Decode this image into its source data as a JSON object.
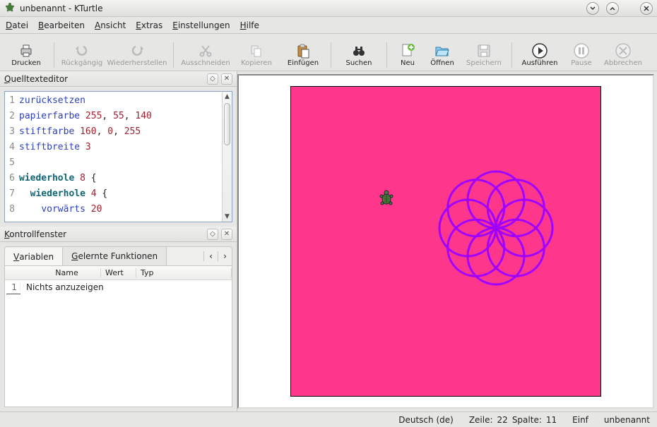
{
  "window": {
    "title": "unbenannt - KTurtle"
  },
  "menu": {
    "datei": {
      "accel": "D",
      "rest": "atei"
    },
    "bearbeiten": {
      "accel": "B",
      "rest": "earbeiten"
    },
    "ansicht": {
      "accel": "A",
      "rest": "nsicht"
    },
    "extras": {
      "accel": "E",
      "rest": "xtras"
    },
    "einstellungen": {
      "accel": "E",
      "rest": "instellungen"
    },
    "hilfe": {
      "accel": "H",
      "rest": "ilfe"
    }
  },
  "toolbar": {
    "drucken": "Drucken",
    "rueckgaengig": "Rückgängig",
    "wiederherstellen": "Wiederherstellen",
    "ausschneiden": "Ausschneiden",
    "kopieren": "Kopieren",
    "einfuegen": "Einfügen",
    "suchen": "Suchen",
    "neu": "Neu",
    "oeffnen": "Öffnen",
    "speichern": "Speichern",
    "ausfuehren": "Ausführen",
    "pause": "Pause",
    "abbrechen": "Abbrechen"
  },
  "panels": {
    "editor_title": {
      "accel": "Q",
      "rest": "uelltexteditor"
    },
    "inspector_title": {
      "accel": "K",
      "rest": "ontrollfenster"
    }
  },
  "code": {
    "lines": [
      {
        "n": "1",
        "tokens": [
          {
            "t": "cmd",
            "v": "zurücksetzen"
          }
        ]
      },
      {
        "n": "2",
        "tokens": [
          {
            "t": "cmd",
            "v": "papierfarbe "
          },
          {
            "t": "num",
            "v": "255"
          },
          {
            "t": "",
            "v": ", "
          },
          {
            "t": "num",
            "v": "55"
          },
          {
            "t": "",
            "v": ", "
          },
          {
            "t": "num",
            "v": "140"
          }
        ]
      },
      {
        "n": "3",
        "tokens": [
          {
            "t": "cmd",
            "v": "stiftfarbe "
          },
          {
            "t": "num",
            "v": "160"
          },
          {
            "t": "",
            "v": ", "
          },
          {
            "t": "num",
            "v": "0"
          },
          {
            "t": "",
            "v": ", "
          },
          {
            "t": "num",
            "v": "255"
          }
        ]
      },
      {
        "n": "4",
        "tokens": [
          {
            "t": "cmd",
            "v": "stiftbreite "
          },
          {
            "t": "num",
            "v": "3"
          }
        ]
      },
      {
        "n": "5",
        "tokens": []
      },
      {
        "n": "6",
        "tokens": [
          {
            "t": "kw",
            "v": "wiederhole"
          },
          {
            "t": "",
            "v": " "
          },
          {
            "t": "num",
            "v": "8"
          },
          {
            "t": "",
            "v": " {"
          }
        ]
      },
      {
        "n": "7",
        "tokens": [
          {
            "t": "",
            "v": "  "
          },
          {
            "t": "kw",
            "v": "wiederhole"
          },
          {
            "t": "",
            "v": " "
          },
          {
            "t": "num",
            "v": "4"
          },
          {
            "t": "",
            "v": " {"
          }
        ]
      },
      {
        "n": "8",
        "tokens": [
          {
            "t": "",
            "v": "    "
          },
          {
            "t": "cmd",
            "v": "vorwärts "
          },
          {
            "t": "num",
            "v": "20"
          }
        ]
      }
    ]
  },
  "inspector": {
    "tab_vars": {
      "accel": "V",
      "rest": "ariablen"
    },
    "tab_funcs": {
      "accel": "G",
      "rest": "elernte Funktionen"
    },
    "col_name": "Name",
    "col_wert": "Wert",
    "col_typ": "Typ",
    "row1_num": "1",
    "row1_text": "Nichts anzuzeigen"
  },
  "canvas": {
    "paper_color": "#ff378c",
    "pen_color": "#a000ff"
  },
  "status": {
    "lang": "Deutsch (de)",
    "line_label": "Zeile:",
    "line": "22",
    "col_label": "Spalte:",
    "col": "11",
    "ins": "Einf",
    "file": "unbenannt"
  }
}
